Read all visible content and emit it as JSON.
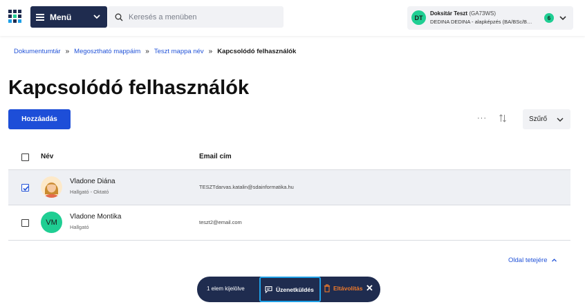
{
  "header": {
    "menu_label": "Menü",
    "search_placeholder": "Keresés a menüben",
    "user": {
      "initials": "DT",
      "name": "Doksitár Teszt",
      "code": "(GA73WS)",
      "program": "DEDINA DEDINA - alapképzés (BA/BSc/B…",
      "badge": "6"
    }
  },
  "breadcrumb": {
    "items": [
      "Dokumentumtár",
      "Megosztható mappáim",
      "Teszt mappa név"
    ],
    "current": "Kapcsolódó felhasználók",
    "separator": "»"
  },
  "page": {
    "title": "Kapcsolódó felhasználók",
    "add_button": "Hozzáadás",
    "more_icon": "···",
    "filter_button": "Szűrő"
  },
  "table": {
    "columns": [
      "Név",
      "Email cím"
    ],
    "rows": [
      {
        "name": "Vladone Diána",
        "role": "Hallgató - Oktató",
        "email": "TESZTdarvas.katalin@sdainformatika.hu",
        "selected": true,
        "avatar": "photo"
      },
      {
        "name": "Vladone Montika",
        "role": "Hallgató",
        "email": "teszt2@email.com",
        "selected": false,
        "avatar": "VM"
      }
    ]
  },
  "back_to_top": "Oldal tetejére",
  "action_bar": {
    "selected_count": "1 elem kijelölve",
    "message_button": "Üzenetküldés",
    "remove_button": "Eltávolítás",
    "close": "✕"
  },
  "colors": {
    "primary": "#1d4ed8",
    "navy": "#1f2c4f",
    "accent_green": "#1fce93",
    "link": "#2253d8",
    "warning": "#f07a2a",
    "focus": "#1ea0e6"
  }
}
